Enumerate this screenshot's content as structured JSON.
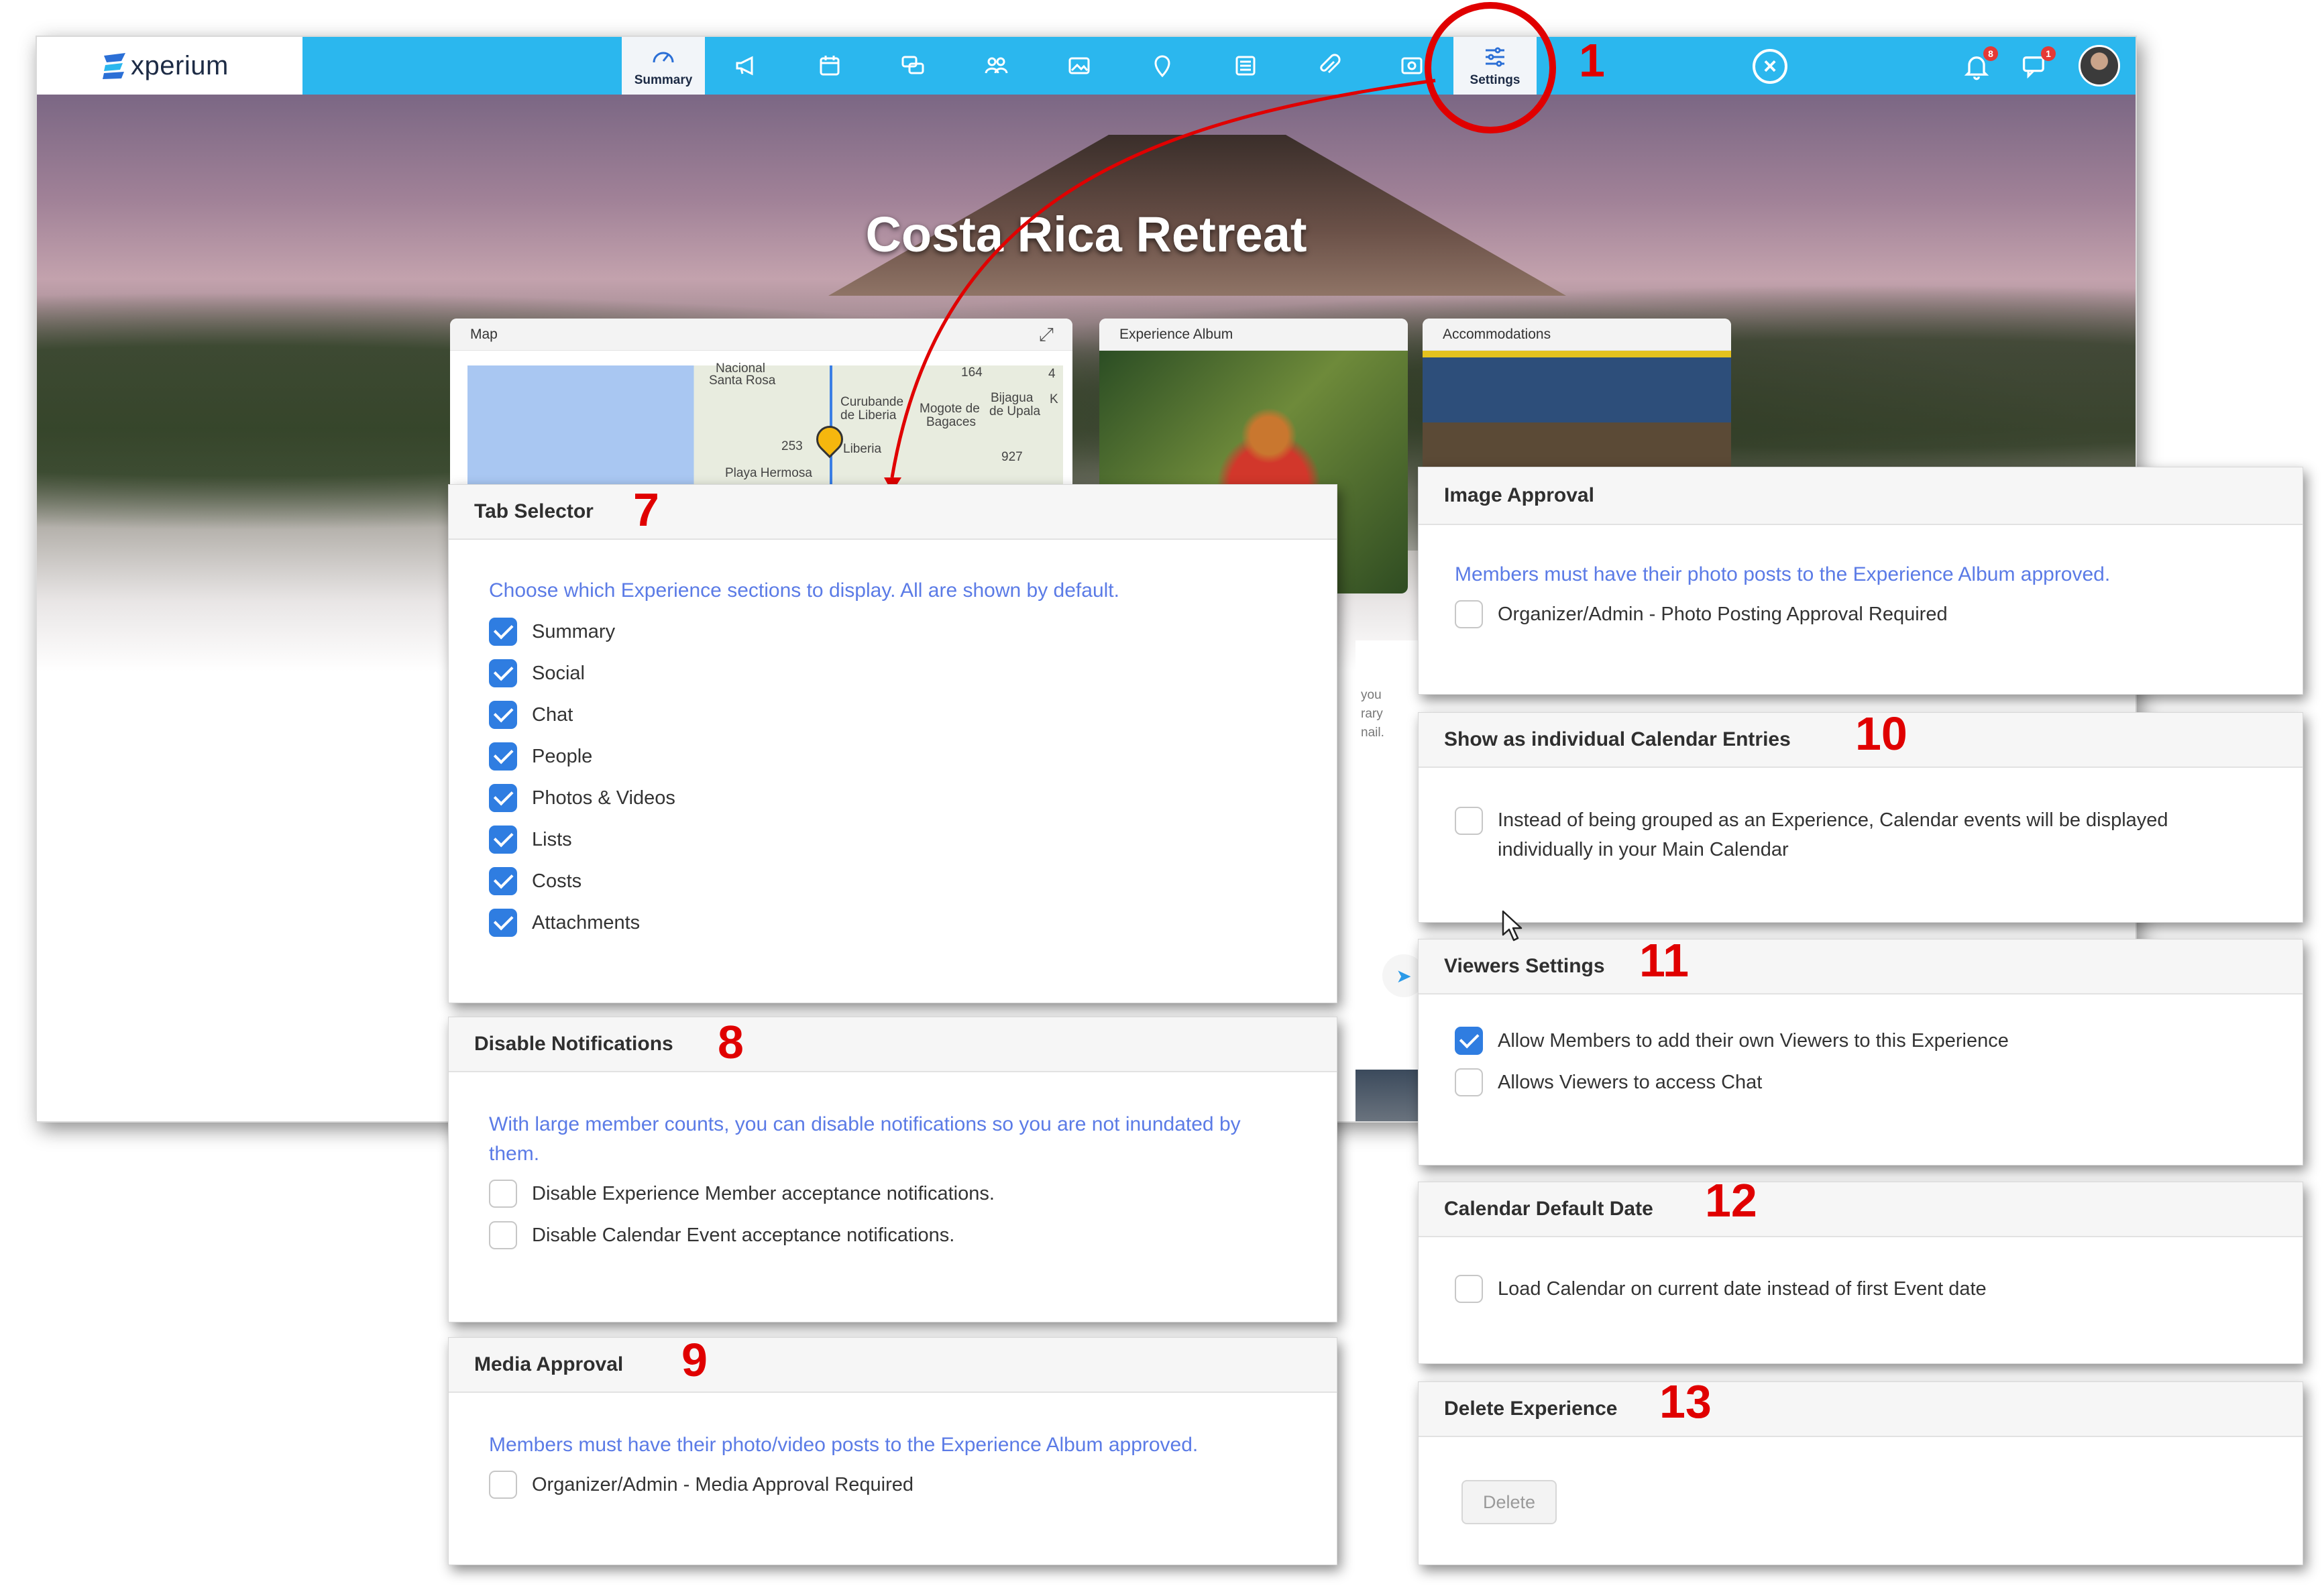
{
  "app": {
    "logo_text": "xperium",
    "nav": [
      {
        "icon": "summary-icon",
        "label": "Summary"
      },
      {
        "icon": "megaphone-icon",
        "label": ""
      },
      {
        "icon": "calendar-icon",
        "label": ""
      },
      {
        "icon": "chat-icon",
        "label": ""
      },
      {
        "icon": "people-icon",
        "label": ""
      },
      {
        "icon": "photo-icon",
        "label": ""
      },
      {
        "icon": "location-pin-icon",
        "label": ""
      },
      {
        "icon": "list-icon",
        "label": ""
      },
      {
        "icon": "paperclip-icon",
        "label": ""
      },
      {
        "icon": "costs-icon",
        "label": ""
      },
      {
        "icon": "settings-sliders-icon",
        "label": "Settings"
      }
    ],
    "notif_count": "8",
    "chat_count": "1",
    "hero_title": "Costa Rica Retreat",
    "map_card_title": "Map",
    "map_labels": [
      "Nacional",
      "Santa Rosa",
      "Curubande",
      "de Liberia",
      "Mogote de",
      "Bagaces",
      "Bijagua",
      "de Upala",
      "Liberia",
      "Playa Hermosa",
      "164",
      "253",
      "927",
      "K",
      "4"
    ],
    "album_card_title": "Experience Album",
    "accom_card_title": "Accommodations",
    "chat_snippet": [
      "you",
      "rary",
      "nail."
    ]
  },
  "annotations": [
    "1",
    "7",
    "8",
    "9",
    "10",
    "11",
    "12",
    "13"
  ],
  "tab_selector": {
    "title": "Tab Selector",
    "description": "Choose which Experience sections to display. All are shown by default.",
    "items": [
      {
        "label": "Summary",
        "checked": true
      },
      {
        "label": "Social",
        "checked": true
      },
      {
        "label": "Chat",
        "checked": true
      },
      {
        "label": "People",
        "checked": true
      },
      {
        "label": "Photos & Videos",
        "checked": true
      },
      {
        "label": "Lists",
        "checked": true
      },
      {
        "label": "Costs",
        "checked": true
      },
      {
        "label": "Attachments",
        "checked": true
      }
    ]
  },
  "disable_notifications": {
    "title": "Disable Notifications",
    "description": "With large member counts, you can disable notifications so you are not inundated by them.",
    "items": [
      {
        "label": "Disable Experience Member acceptance notifications.",
        "checked": false
      },
      {
        "label": "Disable Calendar Event acceptance notifications.",
        "checked": false
      }
    ]
  },
  "media_approval": {
    "title": "Media Approval",
    "description": "Members must have their photo/video posts to the Experience Album approved.",
    "items": [
      {
        "label": "Organizer/Admin - Media Approval Required",
        "checked": false
      }
    ]
  },
  "image_approval": {
    "title": "Image Approval",
    "description": "Members must have their photo posts to the Experience Album approved.",
    "items": [
      {
        "label": "Organizer/Admin - Photo Posting Approval Required",
        "checked": false
      }
    ]
  },
  "calendar_entries": {
    "title": "Show as individual Calendar Entries",
    "items": [
      {
        "label": "Instead of being grouped as an Experience, Calendar events will be displayed individually in your Main Calendar",
        "checked": false
      }
    ]
  },
  "viewers_settings": {
    "title": "Viewers Settings",
    "items": [
      {
        "label": "Allow Members to add their own Viewers to this Experience",
        "checked": true
      },
      {
        "label": "Allows Viewers to access Chat",
        "checked": false
      }
    ]
  },
  "calendar_default": {
    "title": "Calendar Default Date",
    "items": [
      {
        "label": "Load Calendar on current date instead of first Event date",
        "checked": false
      }
    ]
  },
  "delete_experience": {
    "title": "Delete Experience",
    "button_label": "Delete"
  }
}
